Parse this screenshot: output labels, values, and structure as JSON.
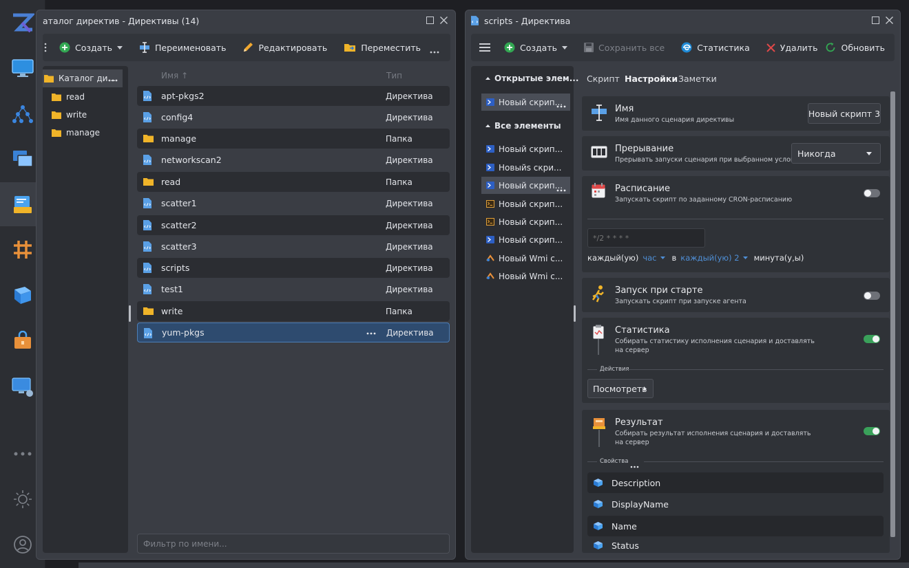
{
  "left_window": {
    "title": "аталог директив - Директивы (14)",
    "toolbar": {
      "create": "Создать",
      "rename": "Переименовать",
      "edit": "Редактировать",
      "move": "Переместить"
    },
    "tree": [
      {
        "label": "Каталог ди...",
        "icon": "folder-icon"
      },
      {
        "label": "read",
        "icon": "folder-icon"
      },
      {
        "label": "write",
        "icon": "folder-icon"
      },
      {
        "label": "manage",
        "icon": "folder-icon"
      }
    ],
    "columns": {
      "name": "Имя ↑",
      "type": "Тип"
    },
    "rows": [
      {
        "name": "apt-pkgs2",
        "type": "Директива",
        "icon": "file-code-icon"
      },
      {
        "name": "config4",
        "type": "Директива",
        "icon": "file-code-icon"
      },
      {
        "name": "manage",
        "type": "Папка",
        "icon": "folder-icon"
      },
      {
        "name": "networkscan2",
        "type": "Директива",
        "icon": "file-code-icon"
      },
      {
        "name": "read",
        "type": "Папка",
        "icon": "folder-icon"
      },
      {
        "name": "scatter1",
        "type": "Директива",
        "icon": "file-code-icon"
      },
      {
        "name": "scatter2",
        "type": "Директива",
        "icon": "file-code-icon"
      },
      {
        "name": "scatter3",
        "type": "Директива",
        "icon": "file-code-icon"
      },
      {
        "name": "scripts",
        "type": "Директива",
        "icon": "file-code-icon"
      },
      {
        "name": "test1",
        "type": "Директива",
        "icon": "file-code-icon"
      },
      {
        "name": "write",
        "type": "Папка",
        "icon": "folder-icon"
      },
      {
        "name": "yum-pkgs",
        "type": "Директива",
        "icon": "file-code-icon",
        "selected": true
      }
    ],
    "filter_placeholder": "Фильтр по имени..."
  },
  "right_window": {
    "title": "scripts - Директива",
    "toolbar": {
      "create": "Создать",
      "save_all": "Сохранить все",
      "stats": "Статистика",
      "delete": "Удалить",
      "refresh": "Обновить"
    },
    "open_group": "Открытые элем...",
    "open_items": [
      "Новый скрип..."
    ],
    "all_group": "Все элементы",
    "all_items": [
      {
        "label": "Новый скрип...",
        "icon": "powershell-icon"
      },
      {
        "label": "Новыйs скри...",
        "icon": "powershell-icon"
      },
      {
        "label": "Новый скрип...",
        "icon": "powershell-icon",
        "selected": true
      },
      {
        "label": "Новый скрип...",
        "icon": "terminal-icon"
      },
      {
        "label": "Новый скрип...",
        "icon": "terminal-icon"
      },
      {
        "label": "Новый скрип...",
        "icon": "powershell-icon"
      },
      {
        "label": "Новый Wmi с...",
        "icon": "wmi-icon"
      },
      {
        "label": "Новый Wmi с...",
        "icon": "wmi-icon"
      }
    ],
    "tabs": [
      "Скрипт",
      "Настройки",
      "Заметки"
    ],
    "settings": {
      "name": {
        "title": "Имя",
        "sub": "Имя данного сценария директивы",
        "value": "Новый скрипт 3"
      },
      "interrupt": {
        "title": "Прерывание",
        "sub": "Прерывать запуски сценария при выбранном условии",
        "value": "Никогда"
      },
      "schedule": {
        "title": "Расписание",
        "sub": "Запускать скрипт по заданному CRON-расписанию",
        "cron_placeholder": "*/2 * * * *",
        "every": "каждый(ую)",
        "unit": "час",
        "in": "в",
        "every2": "каждый(ую) 2",
        "minute": "минута(у,ы)"
      },
      "startup": {
        "title": "Запуск при старте",
        "sub": "Запускать скрипт при запуске агента"
      },
      "statistics": {
        "title": "Статистика",
        "sub1": "Собирать статистику исполнения сценария и доставлять",
        "sub2": "на сервер",
        "actions_label": "Действия",
        "view_button": "Посмотреть"
      },
      "result": {
        "title": "Результат",
        "sub1": "Собирать результат исполнения сценария и доставлять",
        "sub2": "на сервер",
        "props_label": "Свойства",
        "props": [
          "Description",
          "DisplayName",
          "Name",
          "Status"
        ]
      }
    }
  },
  "colors": {
    "accent_green": "#3aa15a",
    "selection_blue": "#2e4b6f",
    "folder_yellow": "#f0b429",
    "file_blue": "#5aa0e6"
  }
}
